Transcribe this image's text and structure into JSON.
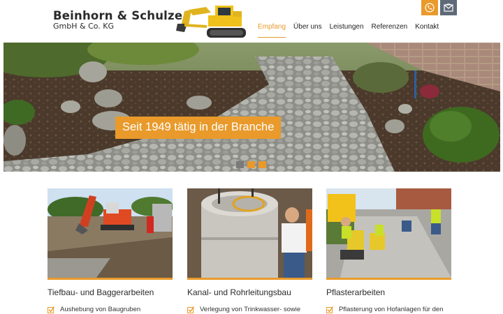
{
  "header": {
    "company_name": "Beinhorn & Schulze",
    "company_form": "GmbH & Co. KG"
  },
  "nav": {
    "items": [
      {
        "label": "Empfang",
        "active": true
      },
      {
        "label": "Über uns",
        "active": false
      },
      {
        "label": "Leistungen",
        "active": false
      },
      {
        "label": "Referenzen",
        "active": false
      },
      {
        "label": "Kontakt",
        "active": false
      }
    ]
  },
  "top_icons": [
    "phone-icon",
    "mail-icon"
  ],
  "hero": {
    "caption": "Seit 1949 tätig in der Branche",
    "slides": 3
  },
  "services": [
    {
      "title": "Tiefbau- und Baggerarbeiten",
      "item": "Aushebung von Baugruben"
    },
    {
      "title": "Kanal- und Rohrleitungsbau",
      "item": "Verlegung von Trinkwasser- sowie"
    },
    {
      "title": "Pflasterarbeiten",
      "item": "Pflasterung von Hofanlagen für den"
    }
  ],
  "colors": {
    "accent": "#e99a2b",
    "icon_dark": "#5e6a78",
    "text": "#2a2a2a"
  }
}
